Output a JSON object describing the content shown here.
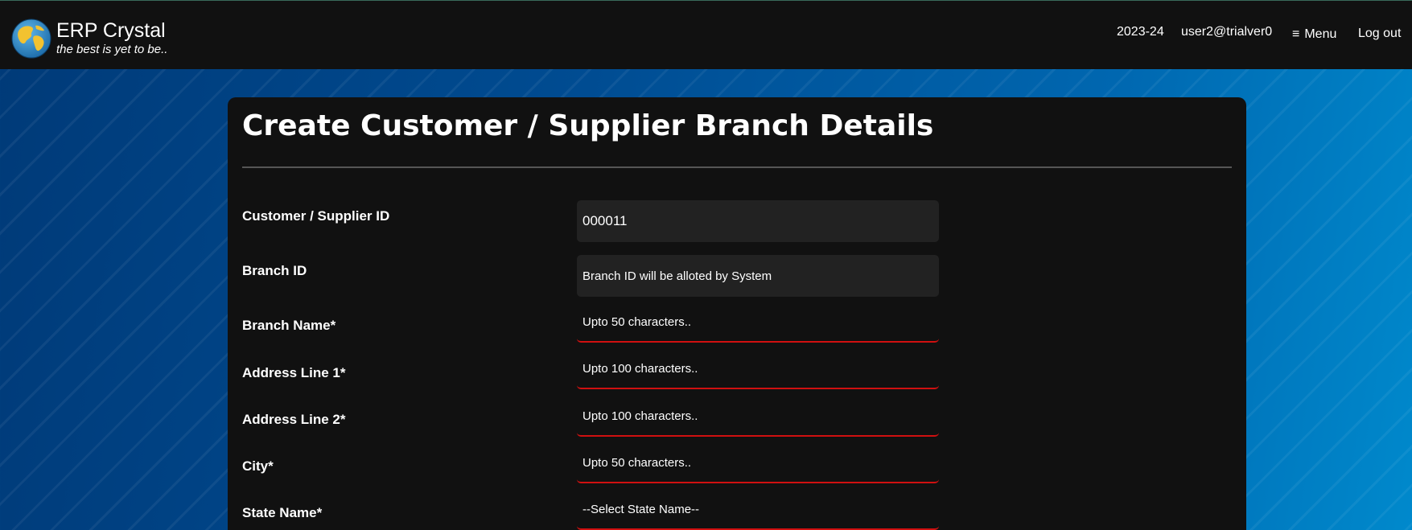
{
  "header": {
    "brand_title": "ERP Crystal",
    "brand_tagline": "the best is yet to be..",
    "logo_icon": "globe-icon",
    "financial_year": "2023-24",
    "user": "user2@trialver0",
    "menu_label": "Menu",
    "menu_icon": "hamburger-icon",
    "logout_label": "Log out"
  },
  "form": {
    "title": "Create Customer / Supplier Branch Details",
    "fields": [
      {
        "label": "Customer / Supplier ID",
        "value": "000011"
      },
      {
        "label": "Branch ID",
        "value": "Branch ID will be alloted by System"
      },
      {
        "label": "Branch Name*",
        "placeholder": "Upto 50 characters.."
      },
      {
        "label": "Address Line 1*",
        "placeholder": "Upto 100 characters.."
      },
      {
        "label": "Address Line 2*",
        "placeholder": "Upto 100 characters.."
      },
      {
        "label": "City*",
        "placeholder": "Upto 50 characters.."
      },
      {
        "label": "State Name*",
        "selected": "--Select State Name--"
      }
    ]
  },
  "colors": {
    "header_bg": "#111111",
    "card_bg": "#111111",
    "readonly_field_bg": "#222222",
    "required_underline": "#d01010",
    "text": "#ffffff"
  }
}
